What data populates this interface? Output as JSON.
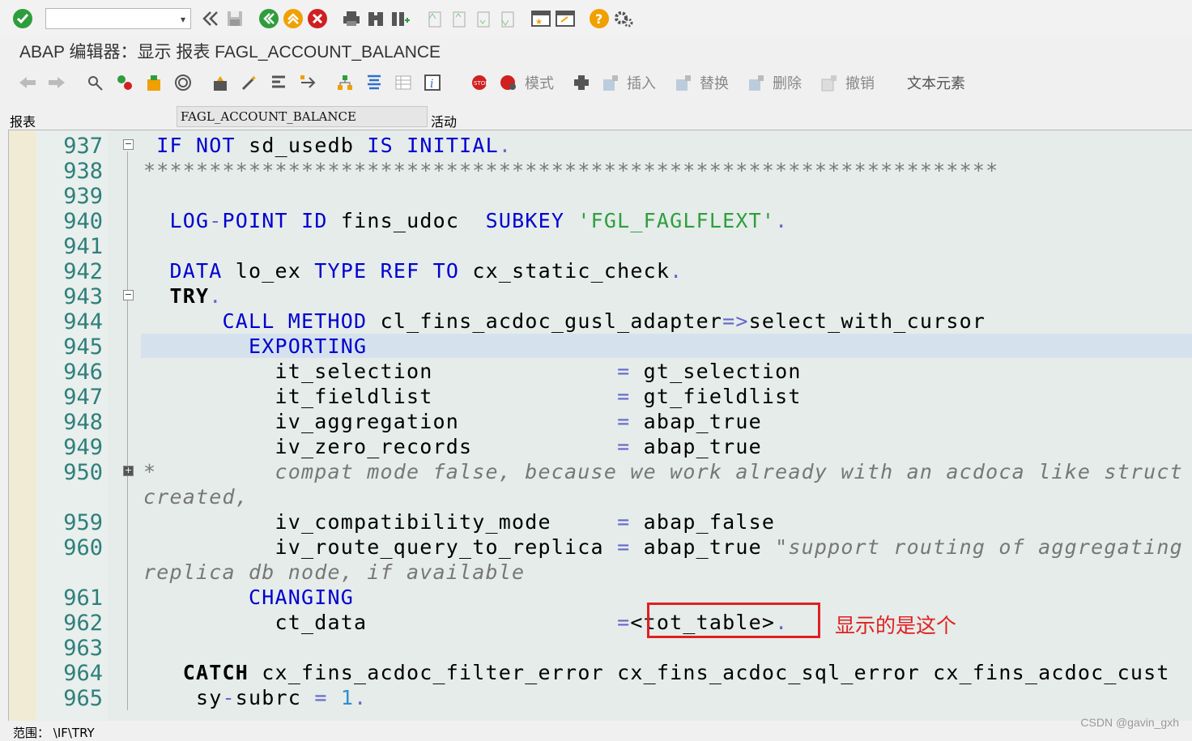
{
  "window": {
    "title": "ABAP 编辑器：显示 报表 FAGL_ACCOUNT_BALANCE"
  },
  "toolbar1": {
    "command_field_value": "",
    "icons": [
      "enter-icon",
      "back-double-icon",
      "save-icon",
      "back-icon",
      "exit-icon",
      "cancel-icon",
      "print-icon",
      "find-icon",
      "find-next-icon",
      "first-page-icon",
      "prev-page-icon",
      "next-page-icon",
      "last-page-icon",
      "new-session-icon",
      "shortcut-icon",
      "help-icon",
      "settings-icon"
    ],
    "colors": {
      "green": "#2e9e3c",
      "orange": "#f0a000",
      "red": "#d02020"
    }
  },
  "toolbar2": {
    "mode_label": "模式",
    "insert_label": "插入",
    "replace_label": "替换",
    "delete_label": "删除",
    "undo_label": "撤销",
    "text_elements_label": "文本元素"
  },
  "field_row": {
    "label": "报表",
    "value": "FAGL_ACCOUNT_BALANCE",
    "status": "活动"
  },
  "editor": {
    "line_numbers": [
      "937",
      "938",
      "939",
      "940",
      "941",
      "942",
      "943",
      "944",
      "945",
      "946",
      "947",
      "948",
      "949",
      "950",
      "959",
      "960",
      "961",
      "962",
      "963",
      "964",
      "965"
    ],
    "lines": {
      "l937a": "IF",
      "l937b": "NOT",
      "l937c": " sd_usedb ",
      "l937d": "IS",
      "l937e": "INITIAL",
      "l937f": ".",
      "l938": "*****************************************************************",
      "l940a": "LOG",
      "l940b": "-",
      "l940c": "POINT",
      "l940d": "ID",
      "l940e": " fins_udoc  ",
      "l940f": "SUBKEY",
      "l940g": "'FGL_FAGLFLEXT'",
      "l940h": ".",
      "l942a": "DATA",
      "l942b": " lo_ex ",
      "l942c": "TYPE",
      "l942d": "REF",
      "l942e": "TO",
      "l942f": " cx_static_check",
      "l942g": ".",
      "l943a": "TRY",
      "l943b": ".",
      "l944a": "CALL",
      "l944b": "METHOD",
      "l944c": " cl_fins_acdoc_gusl_adapter",
      "l944d": "=>",
      "l944e": "select_with_cursor",
      "l945": "EXPORTING",
      "l946a": "it_selection",
      "l946b": "=",
      "l946c": "gt_selection",
      "l947a": "it_fieldlist",
      "l947b": "=",
      "l947c": "gt_fieldlist",
      "l948a": "iv_aggregation",
      "l948b": "=",
      "l948c": "abap_true",
      "l949a": "iv_zero_records",
      "l949b": "=",
      "l949c": "abap_true",
      "l950a": "*",
      "l950b": "compat mode false, because we work already with an acdoca like struct",
      "l950c": "created,",
      "l959a": "iv_compatibility_mode",
      "l959b": "=",
      "l959c": "abap_false",
      "l960a": "iv_route_query_to_replica",
      "l960b": "=",
      "l960c": "abap_true",
      "l960d": "\"support routing of aggregating",
      "l960e": "replica db node, if available",
      "l961": "CHANGING",
      "l962a": "ct_data",
      "l962b": "=",
      "l962c": "<tot_table>",
      "l962d": ".",
      "l964a": "CATCH",
      "l964b": " cx_fins_acdoc_filter_error cx_fins_acdoc_sql_error cx_fins_acdoc_cust",
      "l965a": "sy",
      "l965b": "-",
      "l965c": "subrc ",
      "l965d": "=",
      "l965e": "1",
      "l965f": "."
    },
    "colors": {
      "keyword": "#0000d0",
      "string": "#2e9e3c",
      "comment": "#777777",
      "linenumber": "#2f7f7a",
      "annotation": "#e02020"
    }
  },
  "annotation": {
    "text": "显示的是这个"
  },
  "status_bar": {
    "scope": "范围： \\IF\\TRY"
  },
  "watermark": "CSDN @gavin_gxh"
}
